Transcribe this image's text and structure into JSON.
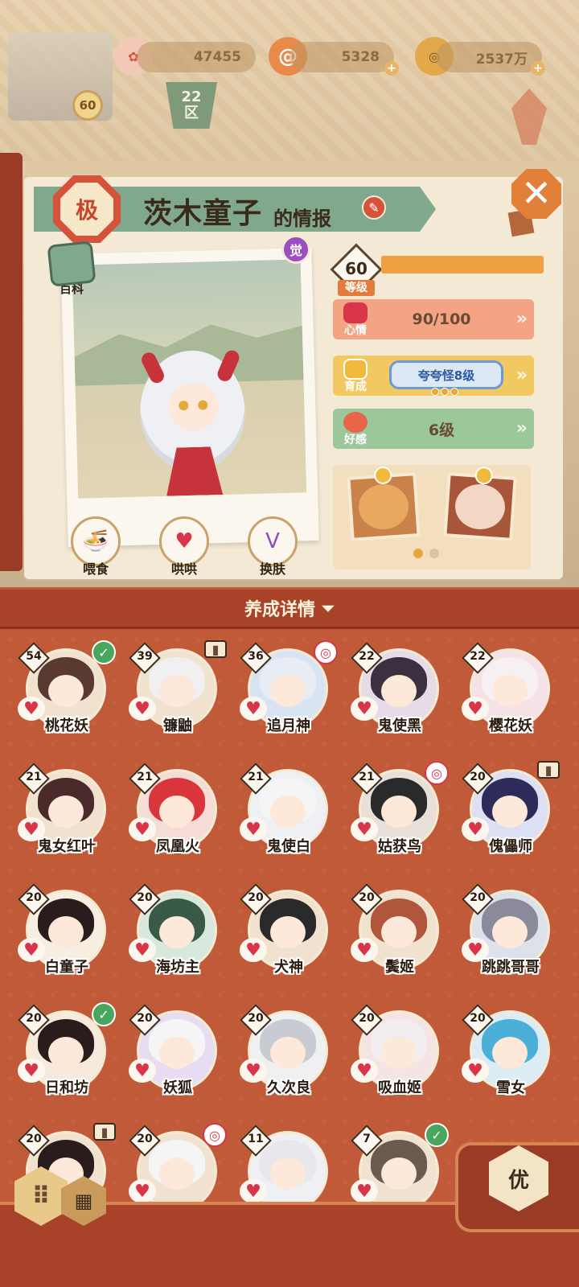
{
  "top": {
    "player_level": "60",
    "zone_num": "22",
    "zone_label": "区",
    "resources": [
      {
        "name": "coin-pink",
        "value": "47455"
      },
      {
        "name": "spiral",
        "value": "5328"
      },
      {
        "name": "gold-coin",
        "value": "2537万"
      }
    ],
    "plus": "+"
  },
  "card": {
    "grade": "极",
    "name": "茨木童子",
    "name_suffix": "的情报",
    "awake_badge": "觉",
    "wiki_label": "百科",
    "close_symbol": "✕",
    "actions": [
      {
        "label": "喂食",
        "icon": "noodle-bowl-icon"
      },
      {
        "label": "哄哄",
        "icon": "milk-carton-icon"
      },
      {
        "label": "换肤",
        "icon": "kimono-icon"
      }
    ],
    "stats": {
      "level_value": "60",
      "level_label": "等级",
      "level_progress": 1.0,
      "mood_label": "心情",
      "mood_value": "90/100",
      "train_label": "育成",
      "train_value": "夸夸怪8级",
      "affection_label": "好感",
      "affection_value": "6级",
      "arrow": "»"
    },
    "gift_page_count": 2,
    "gift_page_active": 0
  },
  "section": {
    "title": "养成详情",
    "chevron": "⌄"
  },
  "characters": [
    {
      "level": "54",
      "name": "桃花妖",
      "mark": "check",
      "hair": "#5a3a30",
      "bg": "#f1e2d0"
    },
    {
      "level": "39",
      "name": "镰鼬",
      "mark": "scroll",
      "hair": "#f0f0f0",
      "bg": "#f1e2d0"
    },
    {
      "level": "36",
      "name": "追月神",
      "mark": "badge",
      "hair": "#e8ecf5",
      "bg": "#d8e4f2"
    },
    {
      "level": "22",
      "name": "鬼使黑",
      "mark": "",
      "hair": "#3a3040",
      "bg": "#e6dce8"
    },
    {
      "level": "22",
      "name": "樱花妖",
      "mark": "",
      "hair": "#f6f0f2",
      "bg": "#f5e2e6"
    },
    {
      "level": "21",
      "name": "鬼女红叶",
      "mark": "",
      "hair": "#4a2a2a",
      "bg": "#f1e2d0"
    },
    {
      "level": "21",
      "name": "凤凰火",
      "mark": "",
      "hair": "#d8363a",
      "bg": "#f6dcd6"
    },
    {
      "level": "21",
      "name": "鬼使白",
      "mark": "",
      "hair": "#f5f5f5",
      "bg": "#eef0f4"
    },
    {
      "level": "21",
      "name": "姑获鸟",
      "mark": "badge",
      "hair": "#2a2a2a",
      "bg": "#e8e0d8"
    },
    {
      "level": "20",
      "name": "傀儡师",
      "mark": "scroll",
      "hair": "#2e2a5a",
      "bg": "#dce0f2"
    },
    {
      "level": "20",
      "name": "白童子",
      "mark": "",
      "hair": "#2a1c1c",
      "bg": "#f6eee0"
    },
    {
      "level": "20",
      "name": "海坊主",
      "mark": "",
      "hair": "#3a5a48",
      "bg": "#d8e8dc"
    },
    {
      "level": "20",
      "name": "犬神",
      "mark": "",
      "hair": "#2a2a2a",
      "bg": "#f1e2d0"
    },
    {
      "level": "20",
      "name": "鬓姬",
      "mark": "",
      "hair": "#b0563a",
      "bg": "#f1e2d0"
    },
    {
      "level": "20",
      "name": "跳跳哥哥",
      "mark": "",
      "hair": "#8a8a9a",
      "bg": "#dde2ea"
    },
    {
      "level": "20",
      "name": "日和坊",
      "mark": "check",
      "hair": "#2a1c1c",
      "bg": "#f6eadc"
    },
    {
      "level": "20",
      "name": "妖狐",
      "mark": "",
      "hair": "#f5f5f5",
      "bg": "#e8dcf2"
    },
    {
      "level": "20",
      "name": "久次良",
      "mark": "",
      "hair": "#c8ccd2",
      "bg": "#eef0f2"
    },
    {
      "level": "20",
      "name": "吸血姬",
      "mark": "",
      "hair": "#f2eef0",
      "bg": "#f4e4e4"
    },
    {
      "level": "20",
      "name": "雪女",
      "mark": "",
      "hair": "#4ab0d8",
      "bg": "#dcecf4"
    },
    {
      "level": "20",
      "name": "",
      "mark": "scroll",
      "hair": "#2a1c1c",
      "bg": "#f1e2d0"
    },
    {
      "level": "20",
      "name": "",
      "mark": "badge",
      "hair": "#f5f5f5",
      "bg": "#f1e2d0"
    },
    {
      "level": "11",
      "name": "",
      "mark": "",
      "hair": "#e8e8ec",
      "bg": "#eef0f4"
    },
    {
      "level": "7",
      "name": "",
      "mark": "check",
      "hair": "#6a5a50",
      "bg": "#f1e2d0"
    },
    {
      "level": "",
      "name": "",
      "mark": "",
      "hair": "#c15a39",
      "bg": "#c15a39"
    }
  ],
  "bottom": {
    "priority_label": "优",
    "grid_icon": "⠿",
    "list_icon": "▦"
  }
}
